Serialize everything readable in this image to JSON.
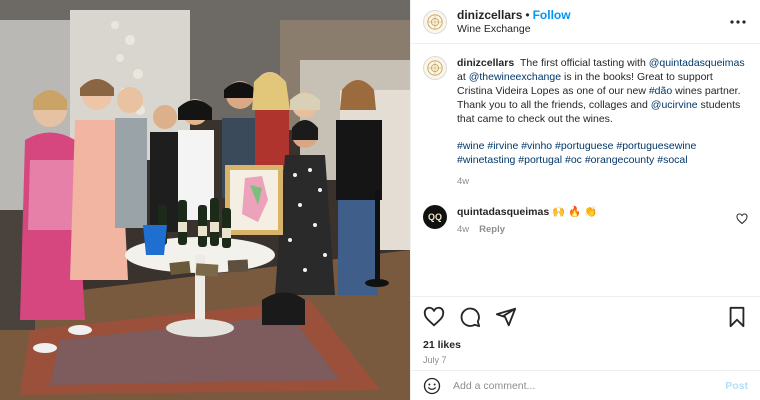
{
  "post": {
    "author": "dinizcellars",
    "follow_label": "Follow",
    "location": "Wine Exchange",
    "caption": {
      "author": "dinizcellars",
      "text_1": "The first official tasting with ",
      "mention_1": "@quintadasqueimas",
      "text_2": " at ",
      "mention_2": "@thewineexchange",
      "text_3": " is in the books! Great to support Cristina Videira Lopes as one of our new ",
      "hashtag_inline": "#dão",
      "text_4": " wines partner. Thank you to all the friends, collages and ",
      "mention_3": "@ucirvine",
      "text_5": " students that came to check out the wines.",
      "hashtags": "#wine #irvine #vinho #portuguese #portuguesewine #winetasting #portugal #oc #orangecounty #socal",
      "time": "4w"
    },
    "comments": [
      {
        "author": "quintadasqueimas",
        "avatar_text": "QQ",
        "text": "🙌 🔥 👏",
        "time": "4w",
        "reply_label": "Reply"
      }
    ],
    "likes": "21 likes",
    "date": "July 7",
    "add_comment_placeholder": "Add a comment...",
    "post_label": "Post"
  },
  "icons": {
    "more": "more-horizontal-icon",
    "like": "heart-icon",
    "comment": "comment-icon",
    "share": "share-icon",
    "save": "bookmark-icon",
    "emoji": "emoji-icon"
  },
  "colors": {
    "link": "#00376b",
    "follow": "#0095f6",
    "muted": "#8e8e8e",
    "post_disabled": "#b2dffc"
  }
}
